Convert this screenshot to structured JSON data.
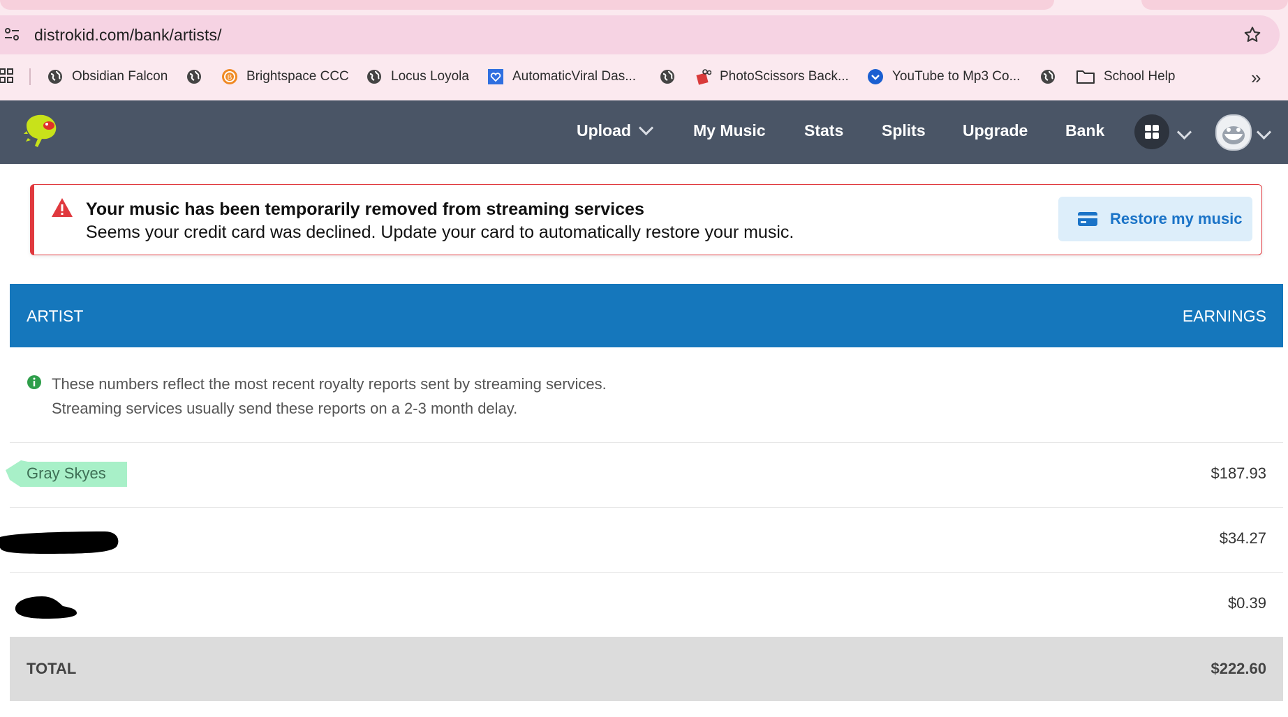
{
  "browser": {
    "url": "distrokid.com/bank/artists/",
    "bookmarks": [
      {
        "label": "Obsidian Falcon",
        "icon": "globe-icon"
      },
      {
        "label": "",
        "icon": "globe-icon"
      },
      {
        "label": "Brightspace CCC",
        "icon": "brightspace-icon"
      },
      {
        "label": "Locus Loyola",
        "icon": "globe-icon"
      },
      {
        "label": "AutomaticViral Das...",
        "icon": "heart-badge-icon"
      },
      {
        "label": "",
        "icon": "globe-icon"
      },
      {
        "label": "PhotoScissors Back...",
        "icon": "scissors-icon"
      },
      {
        "label": "YouTube to Mp3 Co...",
        "icon": "download-check-icon"
      },
      {
        "label": "",
        "icon": "globe-icon"
      },
      {
        "label": "School Help",
        "icon": "folder-icon"
      }
    ],
    "more_label": "»"
  },
  "nav": {
    "items": [
      "Upload",
      "My Music",
      "Stats",
      "Splits",
      "Upgrade",
      "Bank"
    ]
  },
  "alert": {
    "title": "Your music has been temporarily removed from streaming services",
    "body": "Seems your credit card was declined. Update your card to automatically restore your music.",
    "button_label": "Restore my music",
    "color": "#e0393e"
  },
  "table": {
    "header_artist": "ARTIST",
    "header_earnings": "EARNINGS",
    "info_text": "These numbers reflect the most recent royalty reports sent by streaming services. Streaming services usually send these reports on a 2-3 month delay.",
    "rows": [
      {
        "artist": "Gray Skyes",
        "earnings": "$187.93"
      },
      {
        "artist": "",
        "earnings": "$34.27"
      },
      {
        "artist": "",
        "earnings": "$0.39"
      }
    ],
    "total_label": "TOTAL",
    "total_value": "$222.60"
  },
  "colors": {
    "nav_bg": "#4a5566",
    "table_header_bg": "#1577bc",
    "total_bg": "#dcdcdc",
    "highlight": "#a8f0c8",
    "button_text": "#1a73c7"
  }
}
